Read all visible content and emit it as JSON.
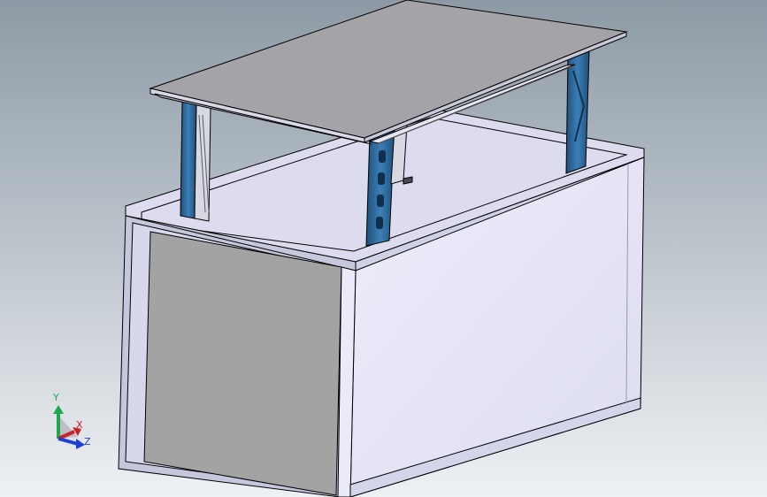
{
  "viewport": {
    "background_top": "#8d9aa5",
    "background_bottom": "#eef1f4"
  },
  "triad": {
    "x_label": "X",
    "y_label": "Y",
    "z_label": "Z",
    "x_color": "#c8232b",
    "y_color": "#1fa84a",
    "z_color": "#1c3fd6"
  },
  "model": {
    "cabinet_face_color": "#e6e6f8",
    "cabinet_panel_color": "#a3a3a3",
    "tabletop_color": "#a4a4a8",
    "leg_color": "#2d6ea3",
    "edge_color": "#000000"
  }
}
